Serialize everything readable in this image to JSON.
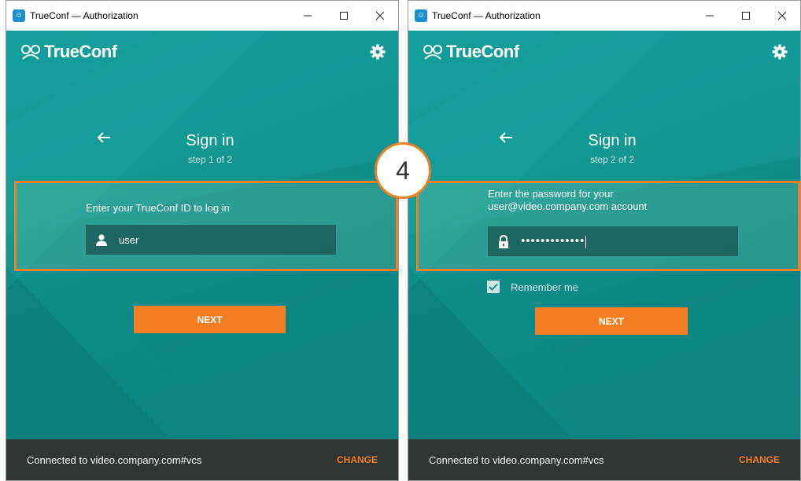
{
  "window_title": "TrueConf — Authorization",
  "app_icon_glyph": "☺",
  "logo_text": "TrueConf",
  "accent_color": "#f47f22",
  "icons": {
    "settings": "gear-icon",
    "back": "arrow-left-icon",
    "user": "user-icon",
    "lock": "lock-icon",
    "check": "checkmark-icon"
  },
  "step1": {
    "title": "Sign in",
    "step": "step 1 of 2",
    "prompt": "Enter your TrueConf ID to log in",
    "username_value": "user",
    "next_label": "NEXT"
  },
  "step2": {
    "title": "Sign in",
    "step": "step 2 of 2",
    "prompt_line1": "Enter the password for your",
    "prompt_line2": "user@video.company.com account",
    "password_masked": "•••••••••••••",
    "remember_label": "Remember me",
    "next_label": "NEXT"
  },
  "footer": {
    "connection": "Connected to video.company.com#vcs",
    "change_label": "CHANGE"
  },
  "badge": "4"
}
